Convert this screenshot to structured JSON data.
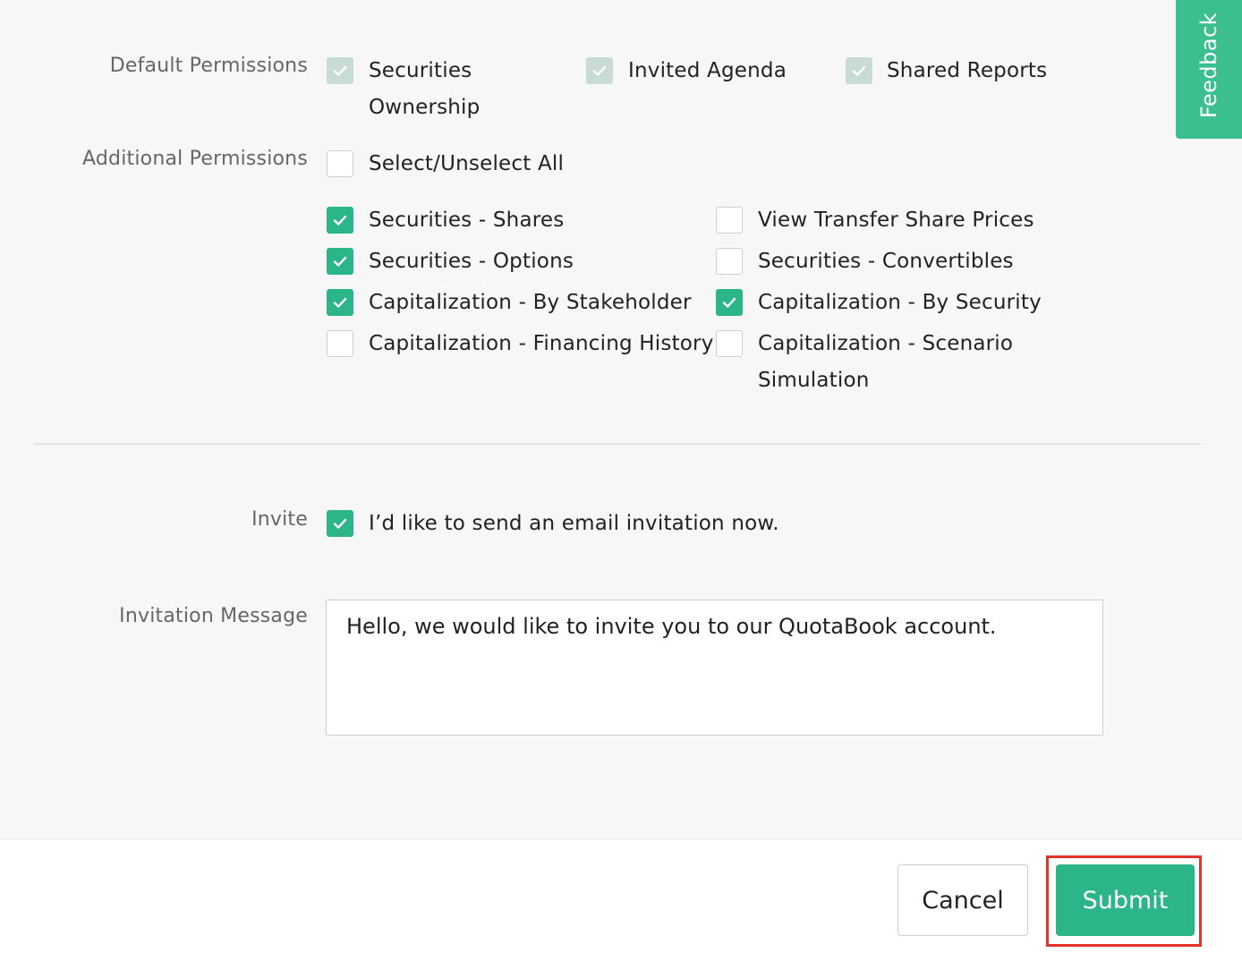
{
  "feedback": {
    "label": "Feedback"
  },
  "default_permissions": {
    "label": "Default Permissions",
    "items": [
      {
        "label_line1": "Securities",
        "label_line2": "Ownership",
        "checked": true
      },
      {
        "label": "Invited Agenda",
        "checked": true
      },
      {
        "label": "Shared Reports",
        "checked": true
      }
    ]
  },
  "additional_permissions": {
    "label": "Additional Permissions",
    "select_all": {
      "label": "Select/Unselect All",
      "checked": false
    },
    "items": [
      {
        "label": "Securities - Shares",
        "checked": true
      },
      {
        "label": "View Transfer Share Prices",
        "checked": false
      },
      {
        "label": "Securities - Options",
        "checked": true
      },
      {
        "label": "Securities - Convertibles",
        "checked": false
      },
      {
        "label": "Capitalization - By Stakeholder",
        "checked": true
      },
      {
        "label": "Capitalization - By Security",
        "checked": true
      },
      {
        "label": "Capitalization - Financing History",
        "checked": false
      },
      {
        "label_line1": "Capitalization - Scenario",
        "label_line2": "Simulation",
        "checked": false
      }
    ]
  },
  "invite": {
    "label": "Invite",
    "option_label": "I’d like to send an email invitation now.",
    "checked": true
  },
  "invitation_message": {
    "label": "Invitation Message",
    "value": "Hello, we would like to invite you to our QuotaBook account."
  },
  "footer": {
    "cancel_label": "Cancel",
    "submit_label": "Submit"
  },
  "colors": {
    "accent": "#2db58a",
    "disabled_check": "#c9dcd4",
    "highlight": "#e5332a"
  }
}
